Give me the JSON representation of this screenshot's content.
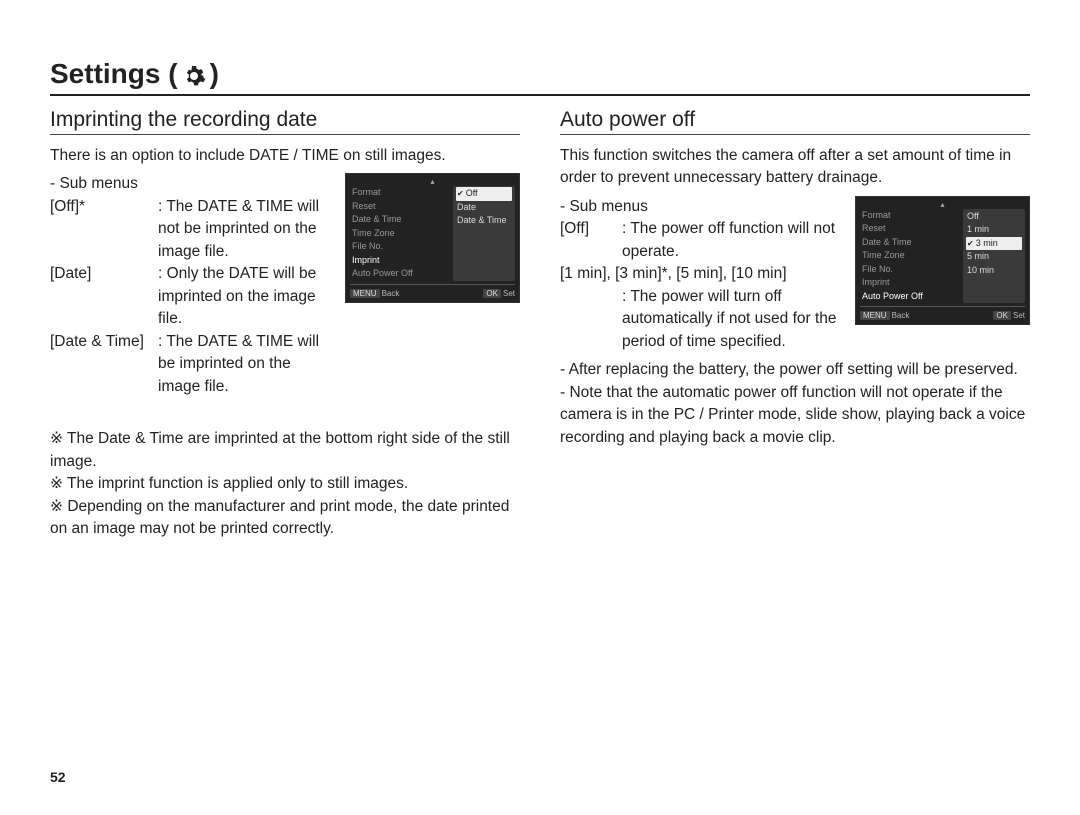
{
  "page": {
    "title": "Settings (",
    "title_close": ")",
    "icon": "gear-icon",
    "number": "52"
  },
  "left": {
    "heading": "Imprinting the recording date",
    "intro": "There is an option to include DATE / TIME on still images.",
    "sub_label": "- Sub menus",
    "items": [
      {
        "term": "[Off]*",
        "def": ": The DATE & TIME will not be imprinted on the image file."
      },
      {
        "term": "[Date]",
        "def": ": Only the DATE will be imprinted on the image file."
      },
      {
        "term": "[Date & Time]",
        "def": ": The DATE & TIME will be imprinted on the image file."
      }
    ],
    "notes": [
      "The Date & Time are imprinted at the bottom right side of the still image.",
      "The imprint function is applied only to still images.",
      "Depending on the manufacturer and print mode, the date printed on an image may not be printed correctly."
    ],
    "screenshot": {
      "menu": [
        "Format",
        "Reset",
        "Date & Time",
        "Time Zone",
        "File No.",
        "Imprint",
        "Auto Power Off"
      ],
      "selected_index": 5,
      "options": [
        "Off",
        "Date",
        "Date & Time"
      ],
      "option_selected_index": 0,
      "back": "Back",
      "set": "Set",
      "back_tag": "MENU",
      "set_tag": "OK"
    }
  },
  "right": {
    "heading": "Auto power off",
    "intro": "This function switches the camera off after a set amount of time in order to prevent unnecessary battery drainage.",
    "sub_label": "- Sub menus",
    "items": [
      {
        "term": "[Off]",
        "def": ": The power off function will not operate."
      },
      {
        "term": "[1 min], [3 min]*, [5 min], [10 min]",
        "def": ": The power will turn off automatically if not used for the period of time specified."
      }
    ],
    "notes": [
      "- After replacing the battery, the power off setting will be preserved.",
      "- Note that the automatic power off function will not operate if the camera is in the PC / Printer mode, slide show, playing back a voice recording and playing back a movie clip."
    ],
    "screenshot": {
      "menu": [
        "Format",
        "Reset",
        "Date & Time",
        "Time Zone",
        "File No.",
        "Imprint",
        "Auto Power Off"
      ],
      "selected_index": 6,
      "options": [
        "Off",
        "1 min",
        "3 min",
        "5 min",
        "10 min"
      ],
      "option_selected_index": 2,
      "back": "Back",
      "set": "Set",
      "back_tag": "MENU",
      "set_tag": "OK"
    }
  },
  "marks": {
    "reference": "※"
  }
}
